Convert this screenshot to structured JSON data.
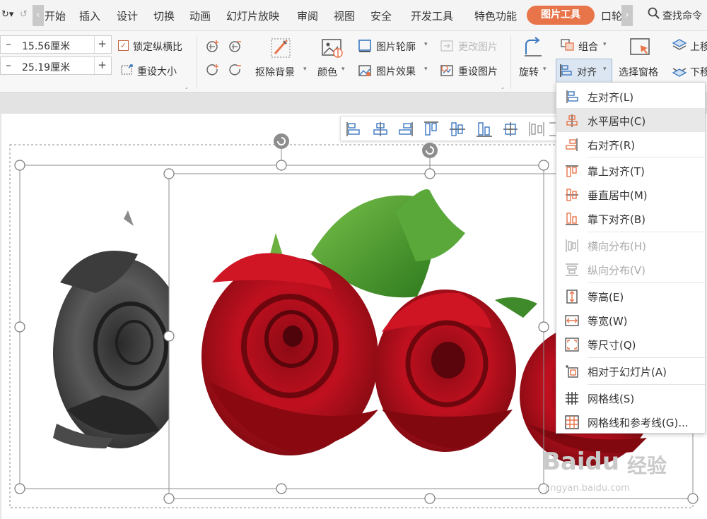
{
  "menu": {
    "tabs": [
      "开始",
      "插入",
      "设计",
      "切换",
      "动画",
      "幻灯片放映",
      "审阅",
      "视图",
      "安全",
      "开发工具",
      "特色功能"
    ],
    "active_tab": "图片工具",
    "partial_tab": "口轮",
    "search": "查找命令"
  },
  "ribbon": {
    "width_value": "15.56厘米",
    "height_value": "25.19厘米",
    "lock_ratio": "锁定纵横比",
    "reset_size": "重设大小",
    "remove_bg": "抠除背景",
    "color": "颜色",
    "picture_outline": "图片轮廓",
    "picture_effect": "图片效果",
    "change_picture": "更改图片",
    "reset_picture": "重设图片",
    "rotate": "旋转",
    "group": "组合",
    "align": "对齐",
    "selection_pane": "选择窗格",
    "bring_forward": "上移",
    "send_backward": "下移"
  },
  "align_menu": [
    {
      "label": "左对齐(L)",
      "icon": "align-left-icon",
      "enabled": true
    },
    {
      "label": "水平居中(C)",
      "icon": "align-center-icon",
      "enabled": true,
      "highlighted": true
    },
    {
      "label": "右对齐(R)",
      "icon": "align-right-icon",
      "enabled": true
    },
    {
      "label": "靠上对齐(T)",
      "icon": "align-top-icon",
      "enabled": true
    },
    {
      "label": "垂直居中(M)",
      "icon": "align-middle-icon",
      "enabled": true
    },
    {
      "label": "靠下对齐(B)",
      "icon": "align-bottom-icon",
      "enabled": true
    },
    {
      "label": "横向分布(H)",
      "icon": "distribute-horizontal-icon",
      "enabled": false
    },
    {
      "label": "纵向分布(V)",
      "icon": "distribute-vertical-icon",
      "enabled": false
    },
    {
      "label": "等高(E)",
      "icon": "same-height-icon",
      "enabled": true
    },
    {
      "label": "等宽(W)",
      "icon": "same-width-icon",
      "enabled": true
    },
    {
      "label": "等尺寸(Q)",
      "icon": "same-size-icon",
      "enabled": true
    },
    {
      "label": "相对于幻灯片(A)",
      "icon": "relative-to-slide-icon",
      "enabled": true
    },
    {
      "label": "网格线(S)",
      "icon": "gridlines-icon",
      "enabled": true
    },
    {
      "label": "网格线和参考线(G)...",
      "icon": "grid-guides-icon",
      "enabled": true
    }
  ],
  "watermark": {
    "brand": "Baidu",
    "product": "经验",
    "url": "jingyan.baidu.com"
  },
  "colors": {
    "accent": "#e8744a",
    "selection": "#a8bcd4",
    "rose_red": "#c0101f",
    "leaf_green": "#4fa02f"
  }
}
